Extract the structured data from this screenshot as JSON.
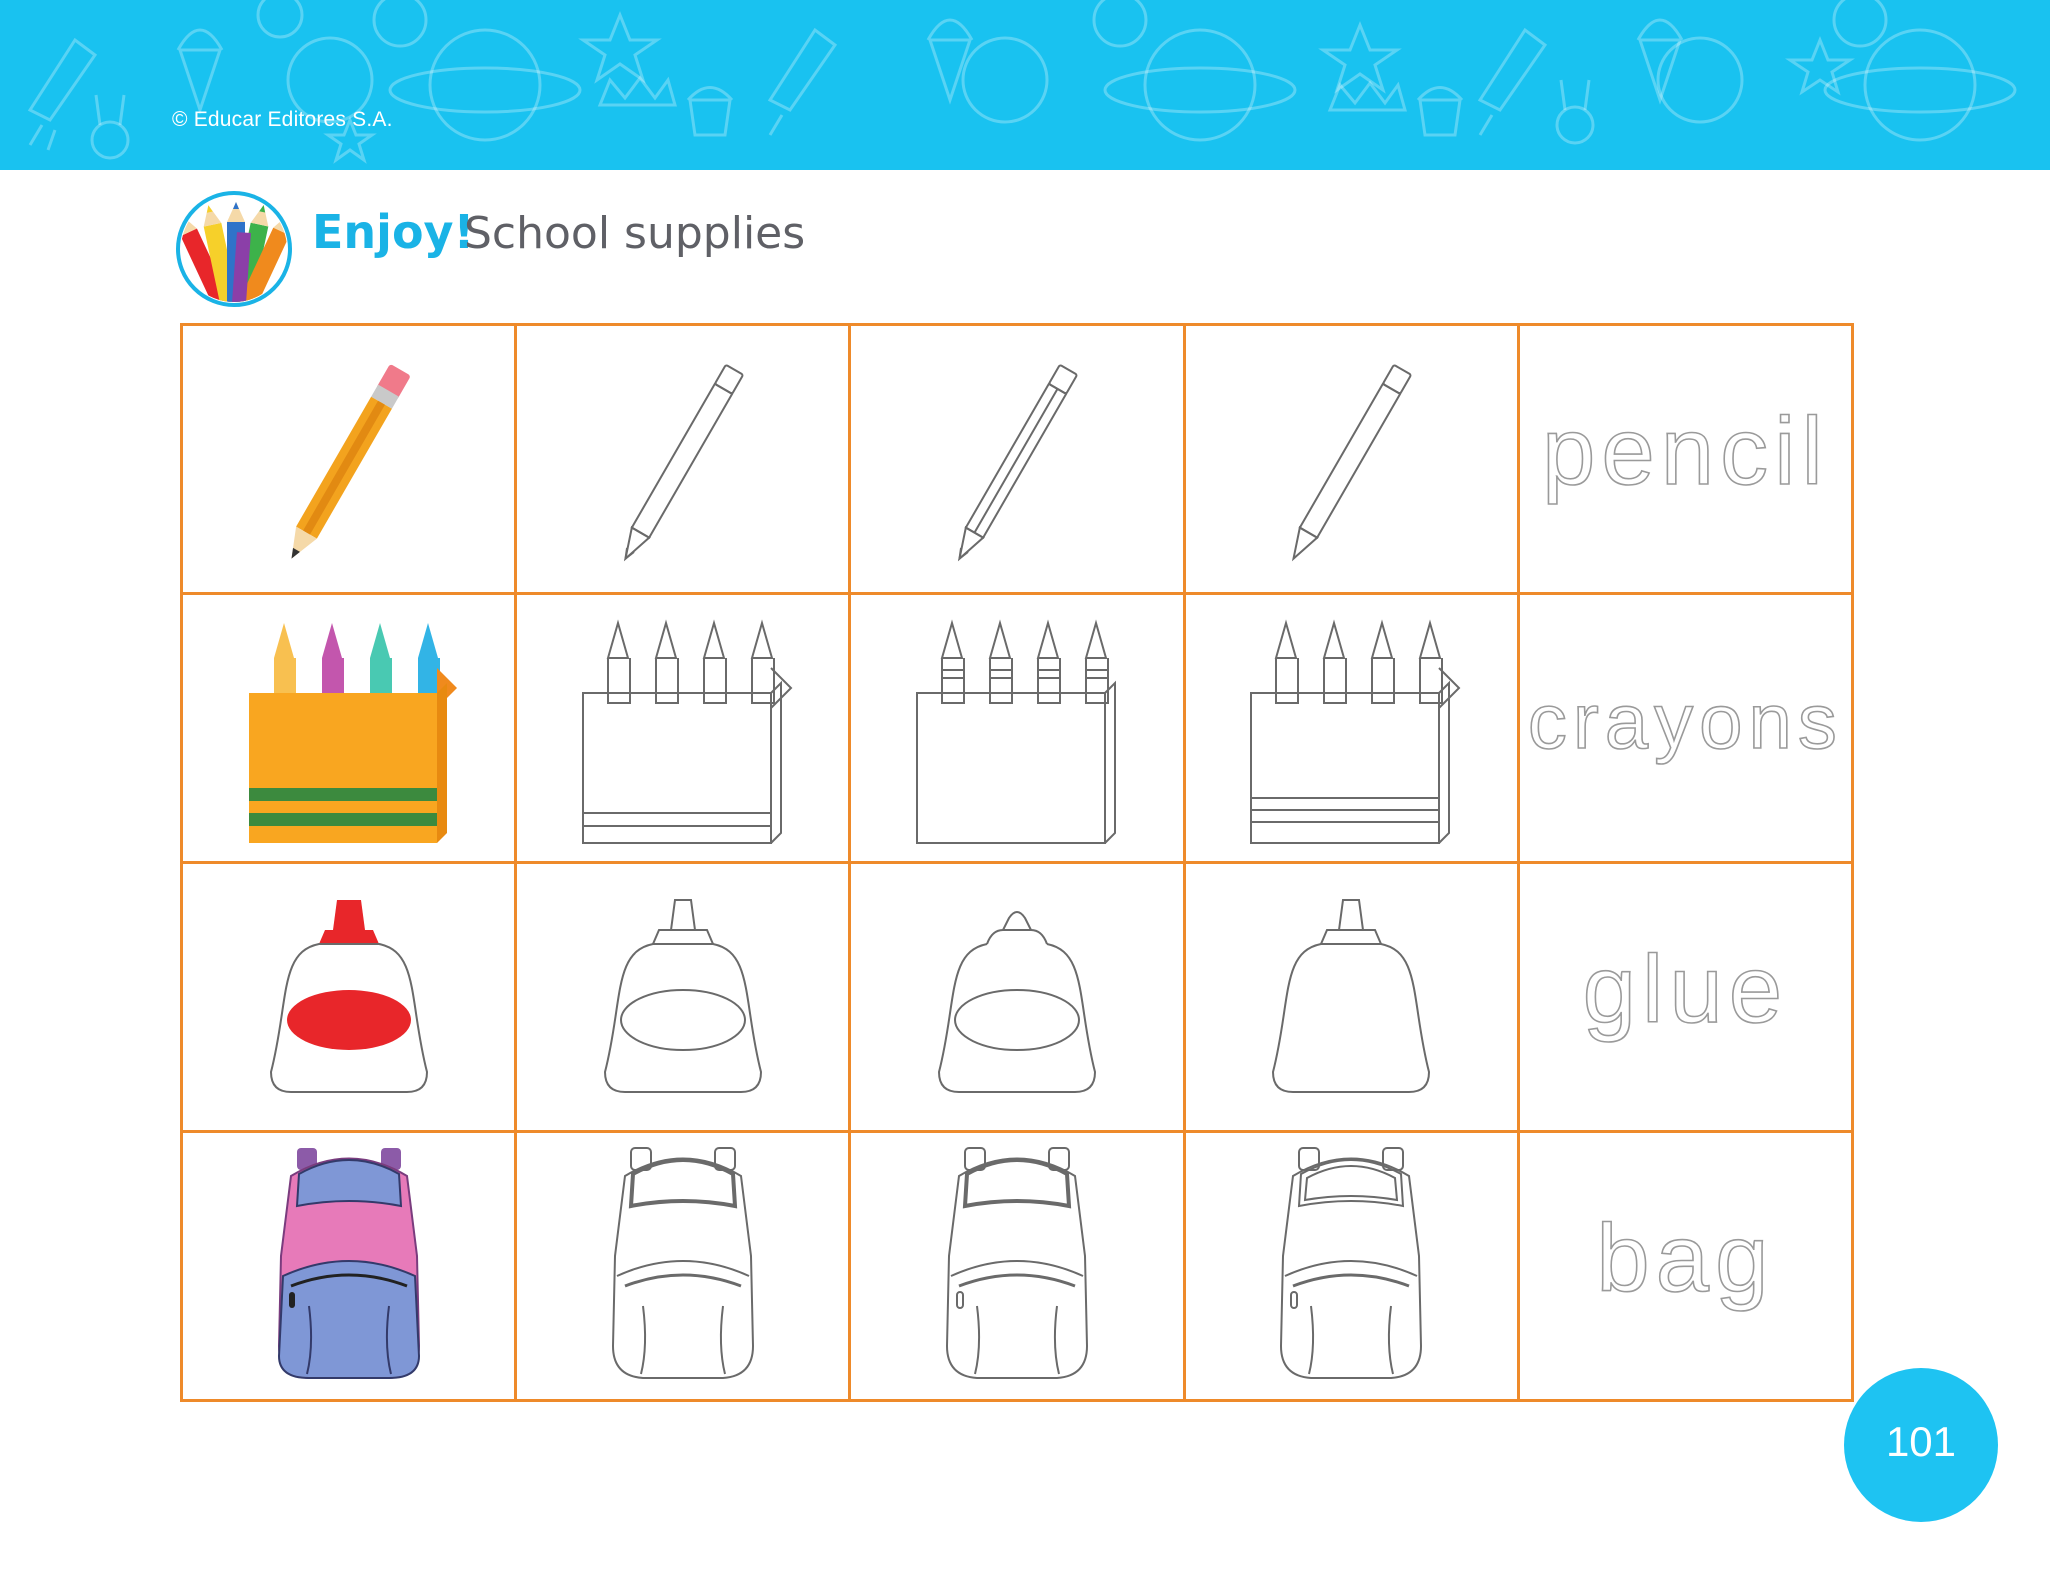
{
  "header": {
    "copyright": "© Educar Editores S.A."
  },
  "heading": {
    "enjoy": "Enjoy!",
    "title": "School supplies",
    "logo_icon": "colored-pencils-icon"
  },
  "rows": [
    {
      "word": "pencil",
      "icon": "pencil-icon"
    },
    {
      "word": "crayons",
      "icon": "crayon-box-icon"
    },
    {
      "word": "glue",
      "icon": "glue-bottle-icon"
    },
    {
      "word": "bag",
      "icon": "backpack-icon"
    }
  ],
  "footer": {
    "page_number": "101"
  },
  "colors": {
    "banner": "#19c2f0",
    "grid_border": "#ee8a2a",
    "enjoy": "#1ab3e6",
    "title": "#5f6066",
    "page_badge": "#1ec3f2"
  }
}
